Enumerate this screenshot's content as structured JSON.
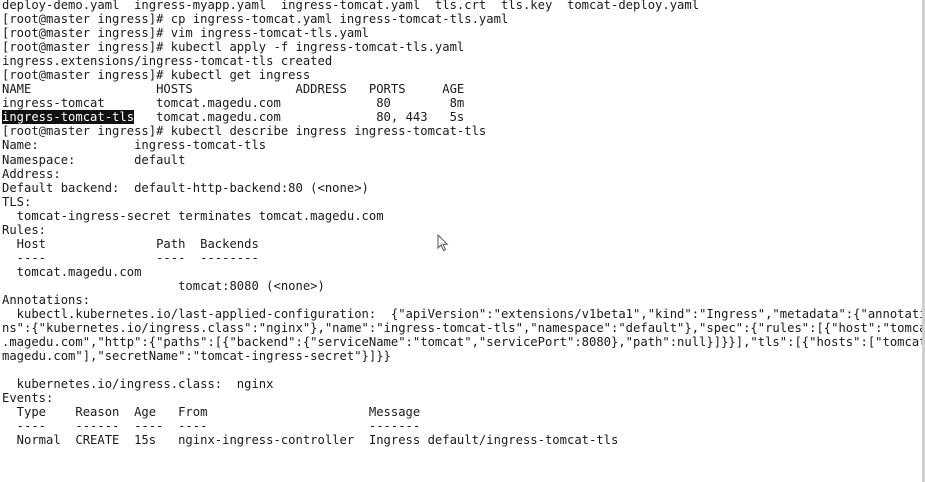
{
  "terminal": {
    "lines": [
      "deploy-demo.yaml  ingress-myapp.yaml  ingress-tomcat.yaml  tls.crt  tls.key  tomcat-deploy.yaml",
      "[root@master ingress]# cp ingress-tomcat.yaml ingress-tomcat-tls.yaml",
      "[root@master ingress]# vim ingress-tomcat-tls.yaml",
      "[root@master ingress]# kubectl apply -f ingress-tomcat-tls.yaml",
      "ingress.extensions/ingress-tomcat-tls created",
      "[root@master ingress]# kubectl get ingress",
      "NAME                 HOSTS              ADDRESS   PORTS     AGE",
      "ingress-tomcat       tomcat.magedu.com             80        8m",
      "",
      "[root@master ingress]# kubectl describe ingress ingress-tomcat-tls",
      "Name:             ingress-tomcat-tls",
      "Namespace:        default",
      "Address:",
      "Default backend:  default-http-backend:80 (<none>)",
      "TLS:",
      "  tomcat-ingress-secret terminates tomcat.magedu.com",
      "Rules:",
      "  Host               Path  Backends",
      "  ----               ----  --------",
      "  tomcat.magedu.com",
      "                        tomcat:8080 (<none>)",
      "Annotations:",
      "  kubectl.kubernetes.io/last-applied-configuration:  {\"apiVersion\":\"extensions/v1beta1\",\"kind\":\"Ingress\",\"metadata\":{\"annotations\":{\"kubernetes.io/ingress.class\":\"nginx\"},\"name\":\"ingress-tomcat-tls\",\"namespace\":\"default\"},\"spec\":{\"rules\":[{\"host\":\"tomcat.magedu.com\",\"http\":{\"paths\":[{\"backend\":{\"serviceName\":\"tomcat\",\"servicePort\":8080},\"path\":null}]}}],\"tls\":[{\"hosts\":[\"tomcat.magedu.com\"],\"secretName\":\"tomcat-ingress-secret\"}]}}",
      "",
      "",
      "",
      "  kubernetes.io/ingress.class:  nginx",
      "Events:",
      "  Type    Reason  Age   From                      Message",
      "  ----    ------  ----  ----                      -------",
      "  Normal  CREATE  15s   nginx-ingress-controller  Ingress default/ingress-tomcat-tls"
    ],
    "highlighted_row": {
      "name": "ingress-tomcat-tls",
      "rest": "   tomcat.magedu.com             80, 443   5s"
    },
    "wrapped": [
      "  kubectl.kubernetes.io/last-applied-configuration:  {\"apiVersion\":\"extensions/v1beta1\",\"kind\":\"Ingress\",\"metadata\":{\"annotatio",
      "ns\":{\"kubernetes.io/ingress.class\":\"nginx\"},\"name\":\"ingress-tomcat-tls\",\"namespace\":\"default\"},\"spec\":{\"rules\":[{\"host\":\"tomcat",
      ".magedu.com\",\"http\":{\"paths\":[{\"backend\":{\"serviceName\":\"tomcat\",\"servicePort\":8080},\"path\":null}]}}],\"tls\":[{\"hosts\":[\"tomcat.",
      "magedu.com\"],\"secretName\":\"tomcat-ingress-secret\"}]}}"
    ]
  },
  "colors": {
    "background": "#ffffff",
    "foreground": "#1a1a1a",
    "selection_bg": "#111111",
    "selection_fg": "#ffffff"
  },
  "icons": {
    "cursor": "mouse-pointer-icon"
  }
}
